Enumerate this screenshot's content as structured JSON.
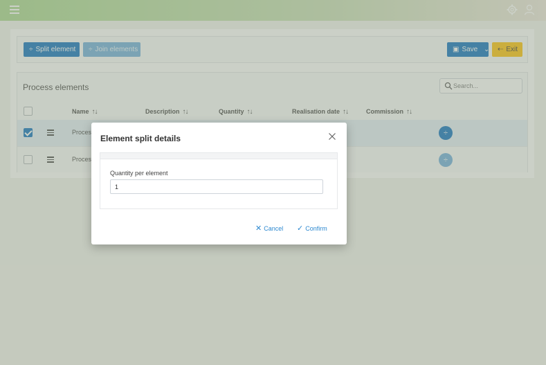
{
  "toolbar": {
    "split_label": "Split element",
    "join_label": "Join elements",
    "save_label": "Save",
    "exit_label": "Exit"
  },
  "panel": {
    "title": "Process elements",
    "search_placeholder": "Search..."
  },
  "table": {
    "columns": [
      "Name",
      "Description",
      "Quantity",
      "Realisation date",
      "Commission"
    ],
    "rows": [
      {
        "name": "Proces1",
        "checked": true
      },
      {
        "name": "Proces2",
        "checked": false
      }
    ]
  },
  "dialog": {
    "title": "Element split details",
    "field_label": "Quantity per element",
    "field_value": "1",
    "cancel_label": "Cancel",
    "confirm_label": "Confirm"
  },
  "icons": {
    "menu": "hamburger-icon",
    "settings": "gear-icon",
    "account": "user-icon",
    "split": "divide-icon",
    "save": "floppy-icon",
    "exit": "sign-out-icon",
    "search": "search-icon",
    "sort": "sort-icon",
    "drag": "drag-handle-icon",
    "close": "close-icon",
    "check": "check-icon"
  },
  "colors": {
    "primary": "#0b6fbf",
    "primary_light": "#6eaedd",
    "warning": "#ffc107",
    "link": "#2c88d0"
  }
}
